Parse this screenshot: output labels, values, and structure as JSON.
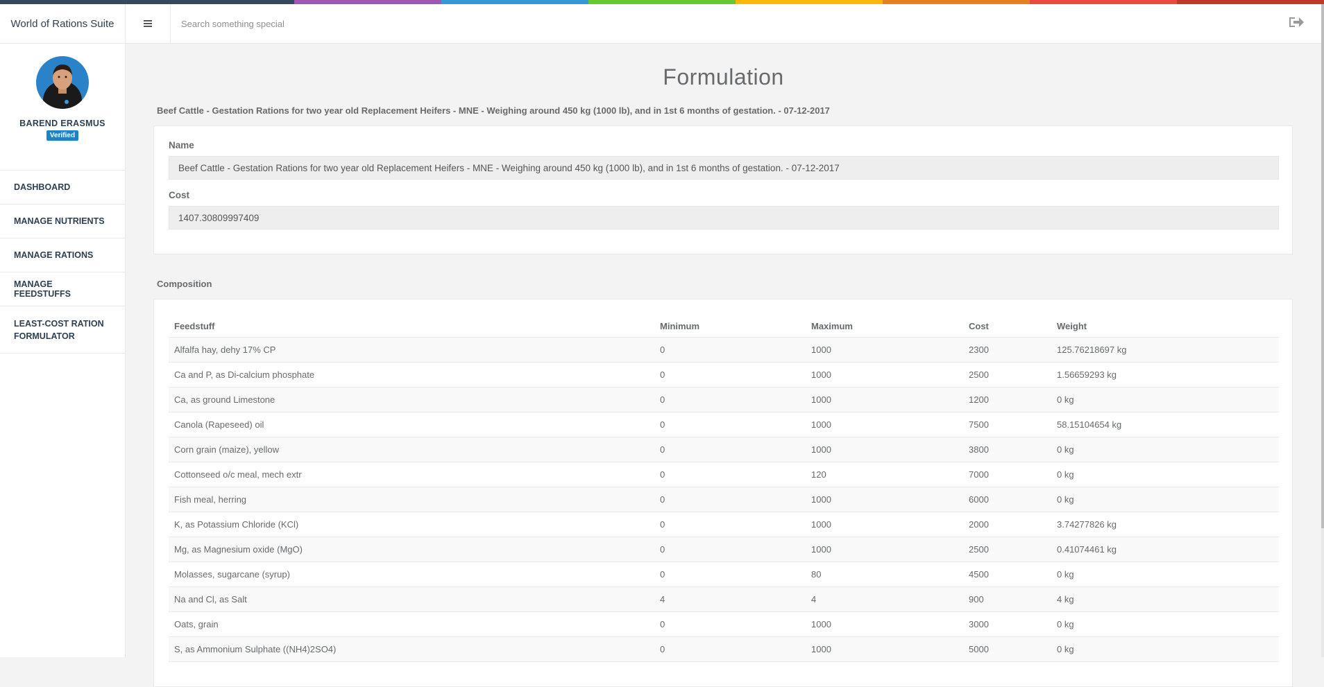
{
  "app": {
    "title": "World of Rations Suite"
  },
  "search": {
    "placeholder": "Search something special"
  },
  "user": {
    "name": "BAREND ERASMUS",
    "badge": "Verified"
  },
  "sidebar": {
    "items": [
      {
        "label": "DASHBOARD"
      },
      {
        "label": "MANAGE NUTRIENTS"
      },
      {
        "label": "MANAGE RATIONS"
      },
      {
        "label": "MANAGE FEEDSTUFFS"
      },
      {
        "label": "LEAST-COST RATION FORMULATOR"
      }
    ]
  },
  "page": {
    "title": "Formulation",
    "subtitle": "Beef Cattle - Gestation Rations for two year old Replacement Heifers - MNE - Weighing around 450 kg (1000 lb), and in 1st 6 months of gestation. - 07-12-2017"
  },
  "form": {
    "name_label": "Name",
    "name_value": "Beef Cattle - Gestation Rations for two year old Replacement Heifers - MNE - Weighing around 450 kg (1000 lb), and in 1st 6 months of gestation. - 07-12-2017",
    "cost_label": "Cost",
    "cost_value": "1407.30809997409"
  },
  "composition": {
    "title": "Composition",
    "columns": [
      "Feedstuff",
      "Minimum",
      "Maximum",
      "Cost",
      "Weight"
    ],
    "rows": [
      [
        "Alfalfa hay, dehy 17% CP",
        "0",
        "1000",
        "2300",
        "125.76218697 kg"
      ],
      [
        "Ca and P, as Di-calcium phosphate",
        "0",
        "1000",
        "2500",
        "1.56659293 kg"
      ],
      [
        "Ca, as ground Limestone",
        "0",
        "1000",
        "1200",
        "0 kg"
      ],
      [
        "Canola (Rapeseed) oil",
        "0",
        "1000",
        "7500",
        "58.15104654 kg"
      ],
      [
        "Corn grain (maize), yellow",
        "0",
        "1000",
        "3800",
        "0 kg"
      ],
      [
        "Cottonseed o/c meal, mech extr",
        "0",
        "120",
        "7000",
        "0 kg"
      ],
      [
        "Fish meal, herring",
        "0",
        "1000",
        "6000",
        "0 kg"
      ],
      [
        "K, as Potassium Chloride (KCl)",
        "0",
        "1000",
        "2000",
        "3.74277826 kg"
      ],
      [
        "Mg, as Magnesium oxide (MgO)",
        "0",
        "1000",
        "2500",
        "0.41074461 kg"
      ],
      [
        "Molasses, sugarcane (syrup)",
        "0",
        "80",
        "4500",
        "0 kg"
      ],
      [
        "Na and Cl, as Salt",
        "4",
        "4",
        "900",
        "4 kg"
      ],
      [
        "Oats, grain",
        "0",
        "1000",
        "3000",
        "0 kg"
      ],
      [
        "S, as Ammonium Sulphate ((NH4)2SO4)",
        "0",
        "1000",
        "5000",
        "0 kg"
      ]
    ]
  },
  "icons": {
    "menu": "hamburger-icon",
    "logout": "sign-out-icon"
  },
  "colors": {
    "sidebar_text": "#2f4050",
    "badge": "#1c84c6",
    "rainbow": [
      "#34495e",
      "#34495e",
      "#9b59b6",
      "#3498db",
      "#62cb31",
      "#ffb606",
      "#e67e22",
      "#e74c3c",
      "#c0392b"
    ]
  }
}
